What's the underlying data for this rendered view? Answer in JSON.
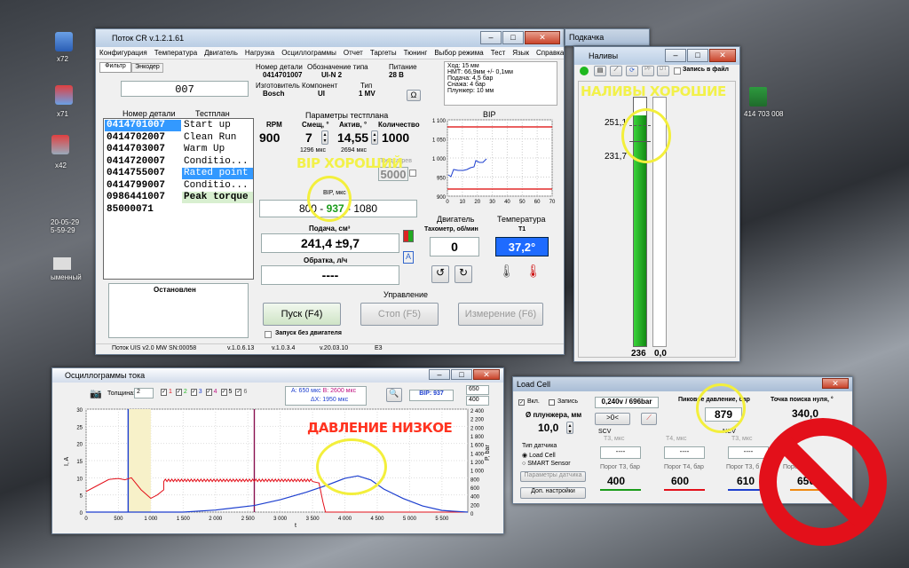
{
  "desktop": {
    "icons": [
      "x72",
      "x71",
      "x42",
      "20-05-29\n5-59-29",
      "ыменный"
    ],
    "xls_label": "414 703 008"
  },
  "main": {
    "title": "Поток CR v.1.2.1.61",
    "menu": [
      "Конфигурация",
      "Температура",
      "Двигатель",
      "Нагрузка",
      "Осциллограммы",
      "Отчет",
      "Таргеты",
      "Тюнинг",
      "Выбор режима",
      "Тест",
      "Язык",
      "Справка"
    ],
    "tabs": [
      "Фильтр",
      "Энкодер"
    ],
    "filter_value": "007",
    "info": {
      "h1": "Номер детали",
      "h2": "Обозначение типа",
      "h3": "Питание",
      "v1": "0414701007",
      "v2": "UI-N 2",
      "v3": "28 В",
      "h4": "Изготовитель",
      "h5": "Компонент",
      "h6": "Тип",
      "v4": "Bosch",
      "v5": "UI",
      "v6": "1 MV",
      "notes": [
        "Ход: 15 мм",
        "НМТ: 66,9мм +/- 0,1мм",
        "Подача: 4,5 бар",
        "Снажа: 4 бар",
        "Плунжер: 10 мм"
      ],
      "omega": "Ω"
    },
    "parts_header": "Номер детали",
    "plan_header": "Тестплан",
    "parts": [
      "0414701007",
      "0414702007",
      "0414703007",
      "0414720007",
      "0414755007",
      "0414799007",
      "0986441007",
      "85000071"
    ],
    "plan": [
      "Start up",
      "Clean Run",
      "Warm Up",
      "Conditio...",
      "Rated point",
      "Conditio...",
      "Peak torque"
    ],
    "status": "Остановлен",
    "params_title": "Параметры тестплана",
    "rpm_h": "RPM",
    "shift_h": "Смещ, °",
    "act_h": "Актив, °",
    "qty_h": "Количество",
    "rpm": "900",
    "shift": "7",
    "act": "14,55",
    "qty": "1000",
    "shift_us": "1296 мкс",
    "act_us": "2694 мкс",
    "preheat": "Предкагрев",
    "preheat_val": "5000",
    "bip_h": "BIP, мкс",
    "bip_lo": "800",
    "bip_mid": "937",
    "bip_hi": "1080",
    "bip_sep": " - ",
    "supply_h": "Подача, см³",
    "supply": "241,4 ±9,7",
    "return_h": "Обратка, л/ч",
    "return": "----",
    "bip_chart_title": "BIP",
    "bip_y": [
      "1 100",
      "1 050",
      "1 000",
      "950",
      "900"
    ],
    "bip_x": [
      "0",
      "10",
      "20",
      "30",
      "40",
      "50",
      "60",
      "70"
    ],
    "engine_h": "Двигатель",
    "temp_h": "Температура",
    "tacho_h": "Тахометр, об/мин",
    "tacho": "0",
    "t1_h": "T1",
    "t1": "37,2°",
    "control_h": "Управление",
    "start": "Пуск (F4)",
    "stop": "Стоп (F5)",
    "measure": "Измерение (F6)",
    "nostart": "Запуск без двигателя",
    "statusbar": [
      "Поток UIS v2.0 MW",
      "SN:00058",
      "v.1.0.6.13",
      "v.1.0.3.4",
      "v.20.03.10",
      "E3"
    ]
  },
  "pod": {
    "title": "Подкачка"
  },
  "naliv": {
    "title": "Наливы",
    "rec": "Запись в файл",
    "pf": "PF",
    "dt": "DT",
    "v1": "251,1",
    "v2": "231,7",
    "b1": "236",
    "b2": "0,0",
    "fill_fraction": 0.93
  },
  "osc": {
    "title": "Осциллограммы тока",
    "thick_l": "Толщина:",
    "thick": "2",
    "checks": [
      "1",
      "2",
      "3",
      "4",
      "5",
      "6"
    ],
    "a": "А: 650 мкс",
    "b": "В: 2600 мкс",
    "dx": "ΔX: 1950 мкс",
    "bip": "BIP: 937",
    "sel1": "650",
    "sel2": "400",
    "ylab": "I, A",
    "y2lab": "P, bar",
    "xlab": "t",
    "yt": [
      "30",
      "25",
      "20",
      "15",
      "10",
      "5",
      "0"
    ],
    "y2t": [
      "2 400",
      "2 200",
      "2 000",
      "1 800",
      "1 600",
      "1 400",
      "1 200",
      "1 000",
      "800",
      "600",
      "400",
      "200",
      "0"
    ],
    "xt": [
      "0",
      "500",
      "1 000",
      "1 500",
      "2 000",
      "2 500",
      "3 000",
      "3 500",
      "4 000",
      "4 500",
      "5 000",
      "5 500"
    ]
  },
  "lc": {
    "title": "Load Cell",
    "on": "Вкл.",
    "rec": "Запись",
    "val": "0,240v / 696bar",
    "peak_h": "Пиковое давление, бар",
    "peak": "879",
    "zero_h": "Точка поиска нуля, °",
    "zero": "340,0",
    "d_h": "Ø плунжера, мм",
    "d": "10,0",
    "sens_h": "Тип датчика",
    "s1": "Load Cell",
    "s2": "SMART Sensor",
    "params": "Параметры датчика",
    "extra": "Доп. настройки",
    "scv": "SCV",
    "ncv": "NCV",
    "t3": "Т3, мкс",
    "t4": "Т4, мкс",
    "t3b": "Т3, мкс",
    "t4b": "Т4",
    "dash": "----",
    "zero_btn": ">0<",
    "p3": "Порог Т3, бар",
    "p4": "Порог Т4, бар",
    "p3b": "Порог Т3, б",
    "p4b": "Порог",
    "v400": "400",
    "v600": "600",
    "v610": "610",
    "v650": "650"
  },
  "anno": {
    "a1": "НАЛИВЫ ХОРОШИЕ",
    "a2": "BIP ХОРОШИЙ",
    "a3": "ДАВЛЕНИЕ НИЗКОЕ"
  },
  "colors": {
    "yellow": "#f3ef3c",
    "red": "#e3101a",
    "green": "#1fb81f",
    "blue": "#1d3fcf"
  }
}
